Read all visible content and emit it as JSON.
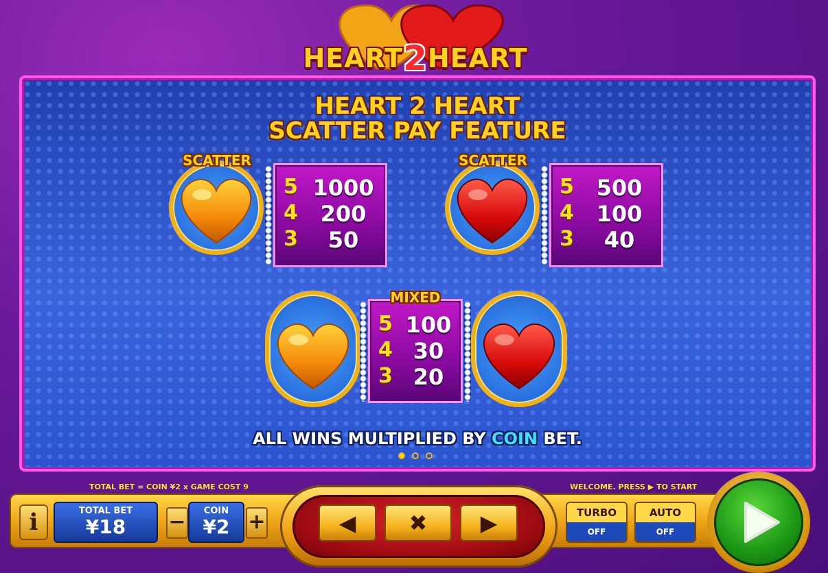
{
  "logo": {
    "left": "HEART",
    "two": "2",
    "right": "HEART"
  },
  "panel": {
    "title_line1": "HEART 2 HEART",
    "title_line2": "SCATTER PAY FEATURE",
    "gold_scatter": {
      "tag": "SCATTER",
      "icon": "gold-heart-icon",
      "pays": [
        {
          "count": "5",
          "value": "1000"
        },
        {
          "count": "4",
          "value": "200"
        },
        {
          "count": "3",
          "value": "50"
        }
      ]
    },
    "red_scatter": {
      "tag": "SCATTER",
      "icon": "red-heart-icon",
      "pays": [
        {
          "count": "5",
          "value": "500"
        },
        {
          "count": "4",
          "value": "100"
        },
        {
          "count": "3",
          "value": "40"
        }
      ]
    },
    "mixed": {
      "tag": "MIXED",
      "pays": [
        {
          "count": "5",
          "value": "100"
        },
        {
          "count": "4",
          "value": "30"
        },
        {
          "count": "3",
          "value": "20"
        }
      ]
    },
    "footer_pre": "ALL WINS MULTIPLIED BY ",
    "footer_highlight": "COIN",
    "footer_post": " BET.",
    "page_indicator": {
      "current": 1,
      "total": 3
    }
  },
  "controls": {
    "total_bet_formula": "TOTAL BET = COIN ¥2 x GAME COST 9",
    "welcome_text": "WELCOME. PRESS ▶ TO START",
    "info_label": "i",
    "total_bet_label": "TOTAL BET",
    "total_bet_value": "¥18",
    "coin_label": "COIN",
    "coin_value": "¥2",
    "minus_label": "−",
    "plus_label": "+",
    "prev_label": "◀",
    "close_label": "✖",
    "next_label": "▶",
    "turbo_label": "TURBO",
    "turbo_state": "OFF",
    "auto_label": "AUTO",
    "auto_state": "OFF"
  },
  "colors": {
    "gold": "#ffd21e",
    "panel_border": "#ff57e8",
    "coin_highlight": "#3ee0ff",
    "spin_green": "#1c9a16"
  }
}
